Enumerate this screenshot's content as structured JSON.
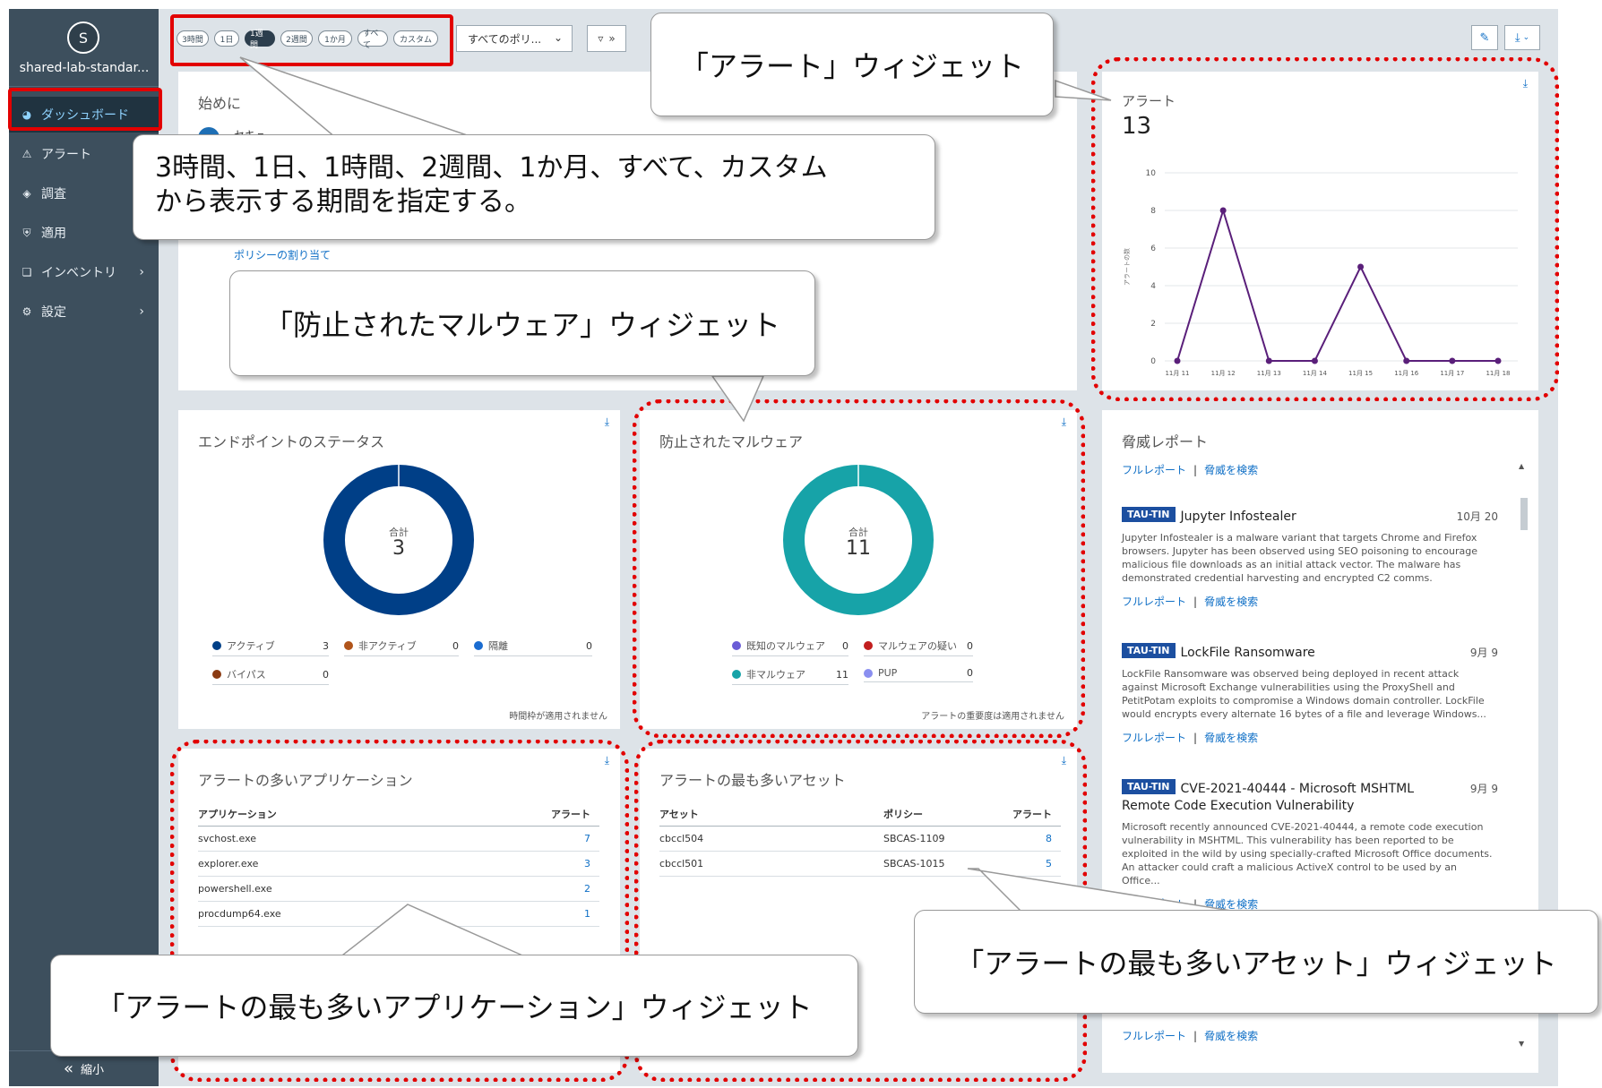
{
  "sidebar": {
    "avatar_letter": "S",
    "org_name": "shared-lab-standar...",
    "items": [
      {
        "label": "ダッシュボード"
      },
      {
        "label": "アラート"
      },
      {
        "label": "調査"
      },
      {
        "label": "適用"
      },
      {
        "label": "インベントリ"
      },
      {
        "label": "設定"
      }
    ],
    "collapse_label": "縮小"
  },
  "toolbar": {
    "timeframes": [
      "3時間",
      "1日",
      "1週間",
      "2週間",
      "1か月",
      "すべて",
      "カスタム"
    ],
    "active_timeframe": "1週間",
    "policy_select": "すべてのポリ...",
    "edit_icon": "pencil-icon",
    "download_icon": "download-icon"
  },
  "getting_started": {
    "title": "始めに",
    "item_text": "セキュ",
    "link": "ポリシーの割り当て"
  },
  "alerts_widget": {
    "title": "アラート",
    "count": "13",
    "y_label": "アラートの数",
    "accent_color": "#5a1f7a"
  },
  "chart_data": {
    "type": "line",
    "title": "",
    "categories": [
      "11月 11",
      "11月 12",
      "11月 13",
      "11月 14",
      "11月 15",
      "11月 16",
      "11月 17",
      "11月 18"
    ],
    "values": [
      0,
      8,
      0,
      0,
      5,
      0,
      0,
      0
    ],
    "ylabel": "アラートの数",
    "ylim": [
      0,
      10
    ],
    "yticks": [
      0,
      2,
      4,
      6,
      8,
      10
    ],
    "grid": true
  },
  "endpoint_status": {
    "title": "エンドポイントのステータス",
    "total_label": "合計",
    "total": "3",
    "legend": [
      {
        "label": "アクティブ",
        "value": "3",
        "color": "#003f87"
      },
      {
        "label": "非アクティブ",
        "value": "0",
        "color": "#b0541a"
      },
      {
        "label": "隔離",
        "value": "0",
        "color": "#1a6cd0"
      },
      {
        "label": "バイパス",
        "value": "0",
        "color": "#8a3a12"
      }
    ],
    "footnote": "時間枠が適用されません"
  },
  "prevented_malware": {
    "title": "防止されたマルウェア",
    "total_label": "合計",
    "total": "11",
    "legend": [
      {
        "label": "既知のマルウェア",
        "value": "0",
        "color": "#6a5cd6"
      },
      {
        "label": "マルウェアの疑い",
        "value": "0",
        "color": "#c21e1e"
      },
      {
        "label": "非マルウェア",
        "value": "11",
        "color": "#17a3a8"
      },
      {
        "label": "PUP",
        "value": "0",
        "color": "#8a8ff0"
      }
    ],
    "footnote": "アラートの重要度は適用されません"
  },
  "threat_report": {
    "title": "脅威レポート",
    "full_report": "フルレポート",
    "search_threat": "脅威を検索",
    "separator": "|",
    "items": [
      {
        "tag": "TAU-TIN",
        "name": "Jupyter Infostealer",
        "date": "10月 20",
        "desc": "Jupyter Infostealer is a malware variant that targets Chrome and Firefox browsers. Jupyter has been observed using SEO poisoning to encourage malicious file downloads as an initial attack vector. The malware has demonstrated credential harvesting and encrypted C2 comms."
      },
      {
        "tag": "TAU-TIN",
        "name": "LockFile Ransomware",
        "date": "9月 9",
        "desc": "LockFile Ransomware was observed being deployed in recent attack against Microsoft Exchange vulnerabilities using the ProxyShell and PetitPotam exploits to compromise a Windows domain controller. LockFile would encrypts every alternate 16 bytes of a file and leverage Windows..."
      },
      {
        "tag": "TAU-TIN",
        "name": "CVE-2021-40444 - Microsoft MSHTML Remote Code Execution Vulnerability",
        "date": "9月 9",
        "desc": "Microsoft recently announced CVE-2021-40444, a remote code execution vulnerability in MSHTML. This vulnerability has been reported to be exploited in the wild by using specially-crafted Microsoft Office documents. An attacker could craft a malicious ActiveX control to be used by an Office..."
      }
    ]
  },
  "top_apps": {
    "title": "アラートの多いアプリケーション",
    "columns": [
      "アプリケーション",
      "アラート"
    ],
    "rows": [
      {
        "app": "svchost.exe",
        "alerts": "7"
      },
      {
        "app": "explorer.exe",
        "alerts": "3"
      },
      {
        "app": "powershell.exe",
        "alerts": "2"
      },
      {
        "app": "procdump64.exe",
        "alerts": "1"
      }
    ]
  },
  "top_assets": {
    "title": "アラートの最も多いアセット",
    "columns": [
      "アセット",
      "ポリシー",
      "アラート"
    ],
    "rows": [
      {
        "asset": "cbccl504",
        "policy": "SBCAS-1109",
        "alerts": "8"
      },
      {
        "asset": "cbccl501",
        "policy": "SBCAS-1015",
        "alerts": "5"
      }
    ]
  },
  "callouts": {
    "timeframe": "3時間、1日、1時間、2週間、1か月、すべて、カスタム\nから表示する期間を指定する。",
    "alerts": "「アラート」ウィジェット",
    "malware": "「防止されたマルウェア」ウィジェット",
    "apps": "「アラートの最も多いアプリケーション」ウィジェット",
    "assets": "「アラートの最も多いアセット」ウィジェット"
  },
  "colors": {
    "sidebar": "#3d4f5d",
    "highlight": "#e20000",
    "endpoint_ring": "#003f87",
    "malware_ring": "#17a3a8",
    "link": "#0f6fc6"
  }
}
